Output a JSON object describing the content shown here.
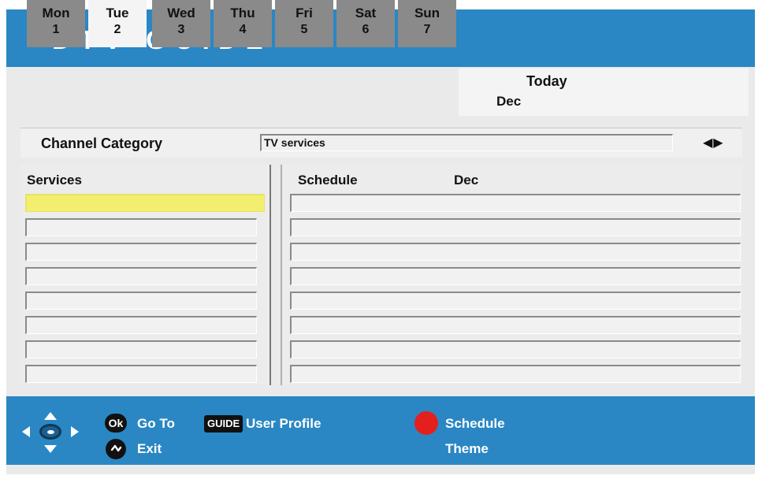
{
  "header": {
    "title": "DTV GUIDE"
  },
  "days": [
    {
      "name": "Mon",
      "date": "1"
    },
    {
      "name": "Tue",
      "date": "2"
    },
    {
      "name": "Wed",
      "date": "3"
    },
    {
      "name": "Thu",
      "date": "4"
    },
    {
      "name": "Fri",
      "date": "5"
    },
    {
      "name": "Sat",
      "date": "6"
    },
    {
      "name": "Sun",
      "date": "7"
    }
  ],
  "active_day": "Tue",
  "today": {
    "label": "Today",
    "month": "Dec"
  },
  "category": {
    "label": "Channel Category",
    "value": "TV services",
    "arrows": "◀▶"
  },
  "services": {
    "heading": "Services"
  },
  "schedule": {
    "heading": "Schedule",
    "month": "Dec"
  },
  "footer": {
    "ok_key": "Ok",
    "goto_label": "Go To",
    "guide_key": "GUIDE",
    "user_profile_label": "User Profile",
    "schedule_label": "Schedule",
    "exit_label": "Exit",
    "theme_label": "Theme"
  },
  "colors": {
    "header_blue": "#2a87c4",
    "selected_row": "#f3ef6e",
    "inactive_tab": "#8a8a8a",
    "red_key": "#e3201e"
  },
  "icons": [
    "dpad-icon",
    "ok-key-icon",
    "guide-key-icon",
    "back-key-icon",
    "red-button-icon",
    "left-right-arrows-icon"
  ]
}
